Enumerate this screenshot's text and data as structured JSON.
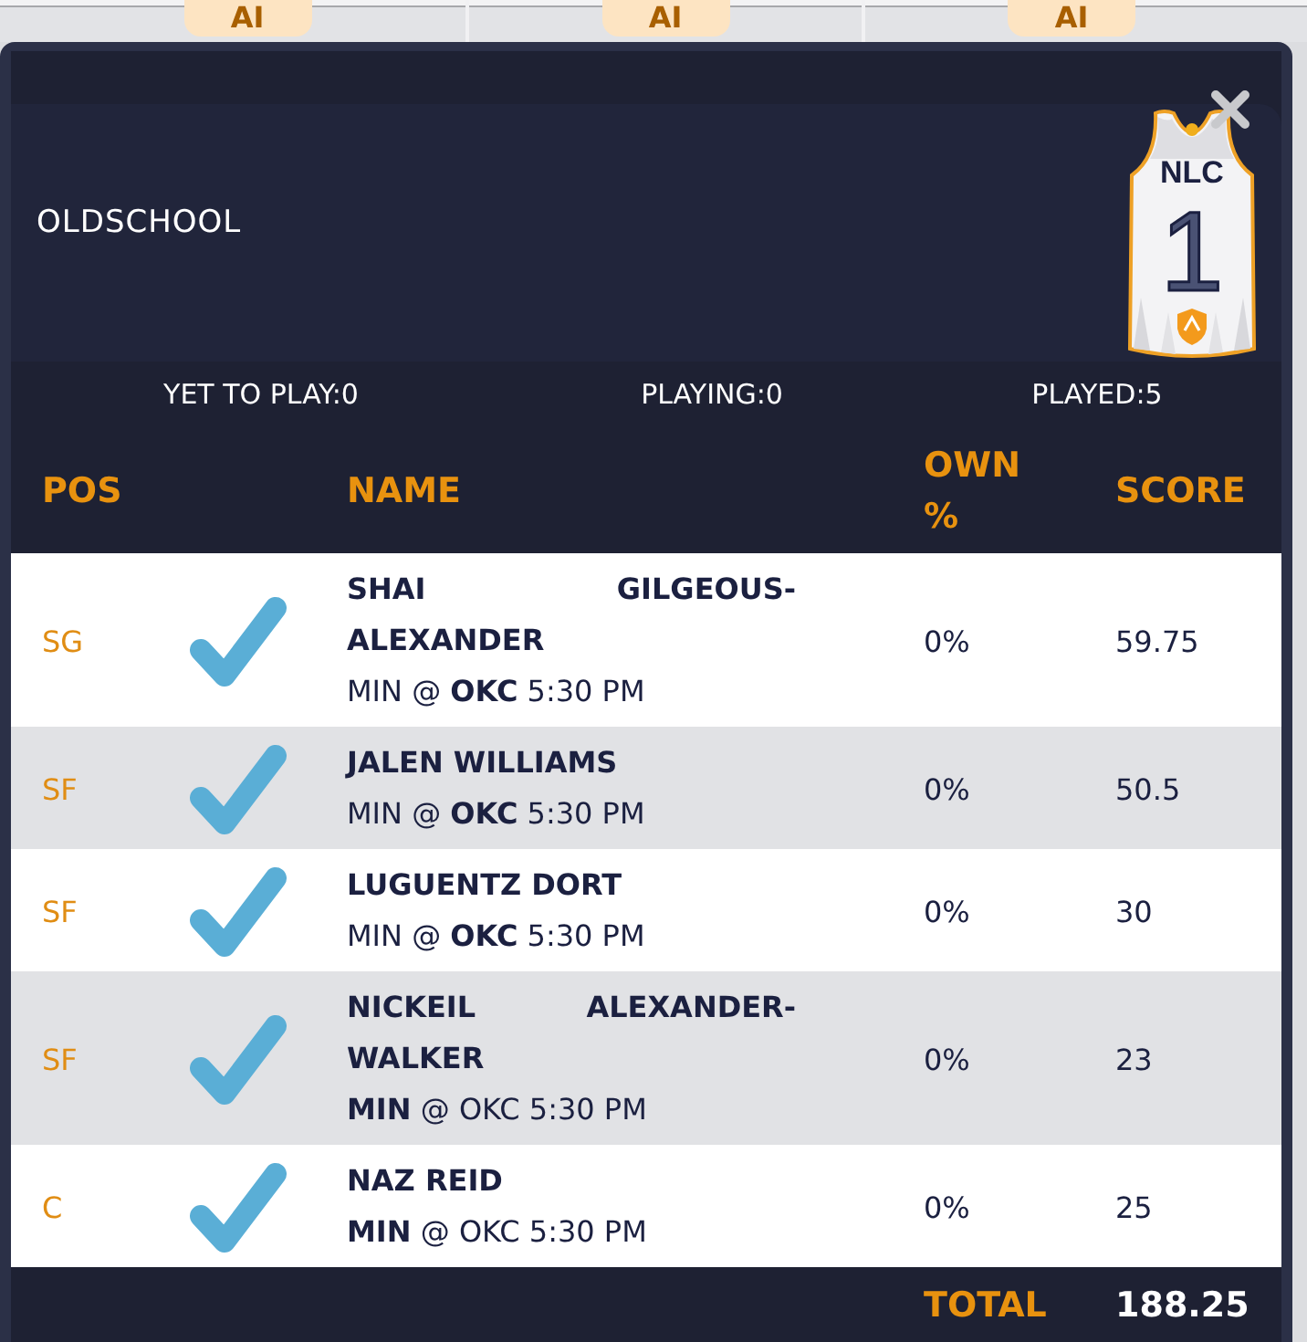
{
  "toolbar_buttons": [
    "AI",
    "AI",
    "AI"
  ],
  "lineup": {
    "title": "OLDSCHOOL",
    "jersey": {
      "lettering": "NLC",
      "number": "1"
    }
  },
  "status_counts": [
    "YET TO PLAY:0",
    "PLAYING:0",
    "PLAYED:5"
  ],
  "table": {
    "columns": [
      "POS",
      "NAME",
      "OWN %",
      "SCORE"
    ],
    "rows": [
      {
        "pos": "SG",
        "checked": true,
        "name": "SHAI GILGEOUS-ALEXANDER",
        "game": "MIN @ **OKC** 5:30 PM",
        "own": "0%",
        "score": "59.75"
      },
      {
        "pos": "SF",
        "checked": true,
        "name": "JALEN WILLIAMS",
        "game": "MIN @ **OKC** 5:30 PM",
        "own": "0%",
        "score": "50.5"
      },
      {
        "pos": "SF",
        "checked": true,
        "name": "LUGUENTZ DORT",
        "game": "MIN @ **OKC** 5:30 PM",
        "own": "0%",
        "score": "30"
      },
      {
        "pos": "SF",
        "checked": true,
        "name": "NICKEIL ALEXANDER-WALKER",
        "game": "**MIN** @ OKC 5:30 PM",
        "own": "0%",
        "score": "23"
      },
      {
        "pos": "C",
        "checked": true,
        "name": "NAZ REID",
        "game": "**MIN** @ OKC 5:30 PM",
        "own": "0%",
        "score": "25"
      }
    ],
    "total": {
      "label": "TOTAL",
      "value": "188.25"
    }
  }
}
